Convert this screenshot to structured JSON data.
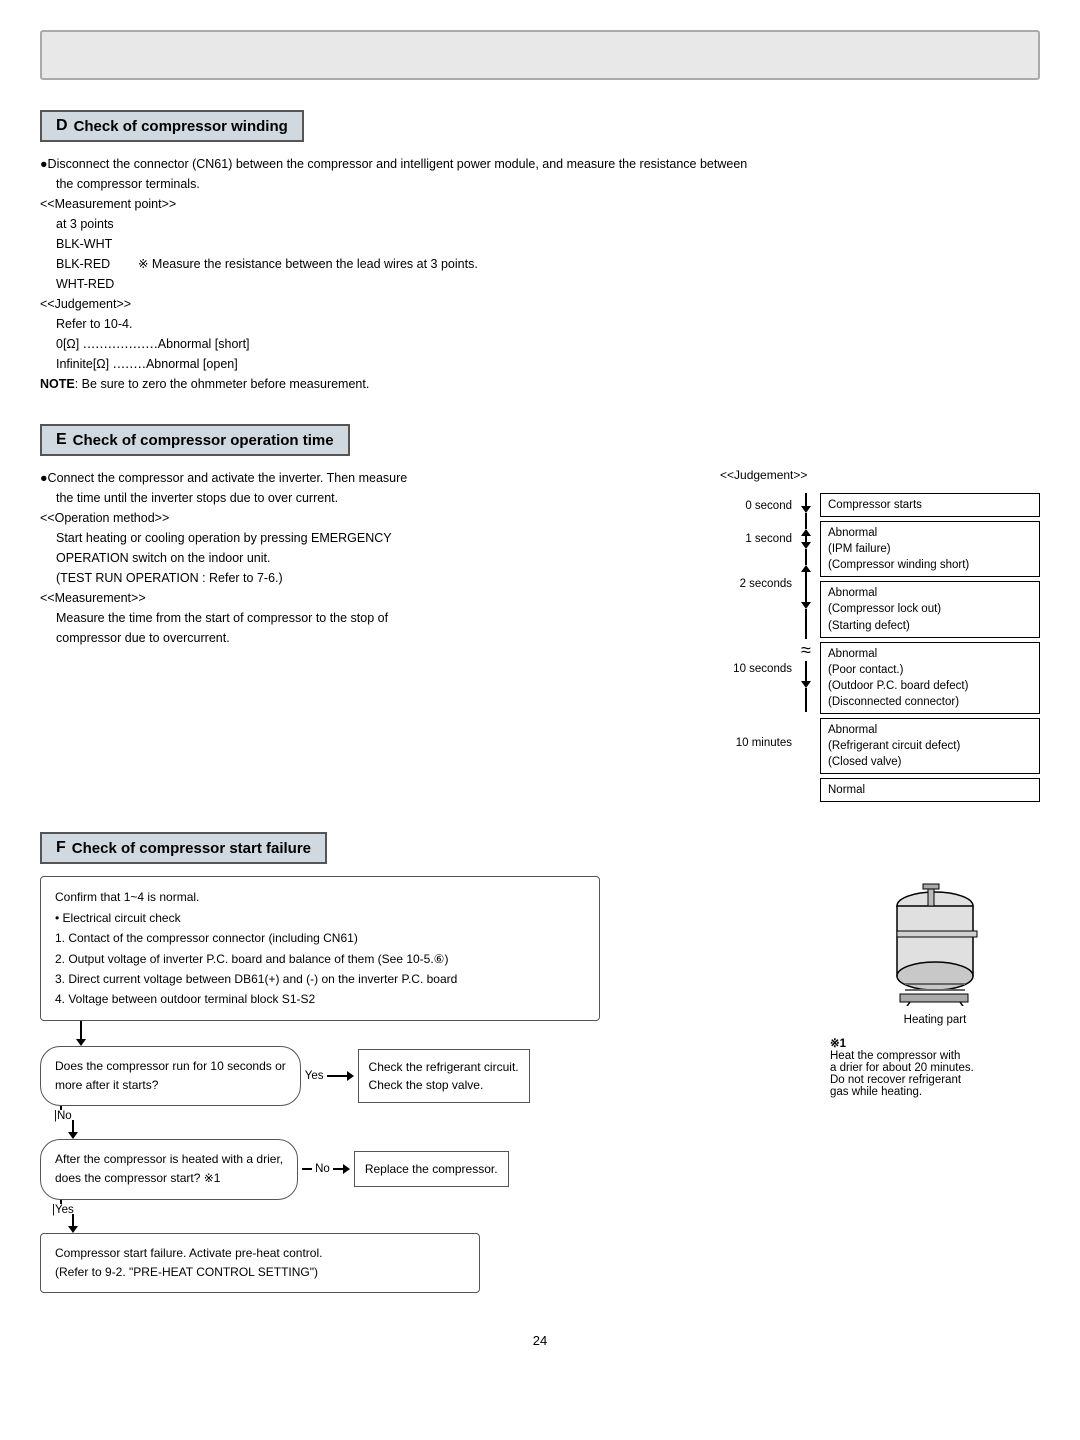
{
  "header": {},
  "sectionD": {
    "letter": "D",
    "title": "Check of compressor winding",
    "para1": "●Disconnect the connector (CN61) between the compressor and intelligent power module, and measure the resistance between",
    "para1b": "the compressor terminals.",
    "measurement_point": "<<Measurement point>>",
    "at3": "at 3 points",
    "blk_wht": "BLK-WHT",
    "blk_red": "BLK-RED",
    "note_measure": "※ Measure the resistance between the lead wires at 3 points.",
    "wht_red": "WHT-RED",
    "judgement": "<<Judgement>>",
    "refer": "Refer to 10-4.",
    "zero": "0[Ω] ‥‥‥‥‥‥‥‥‥Abnormal [short]",
    "infinite": "Infinite[Ω] ‥‥‥‥Abnormal [open]",
    "note": "NOTE",
    "note_text": ": Be sure to zero the ohmmeter before measurement."
  },
  "sectionE": {
    "letter": "E",
    "title": "Check of compressor operation time",
    "para1": "●Connect the compressor and activate the inverter. Then measure",
    "para1b": "the time until the inverter stops due to over current.",
    "op_method": "<<Operation method>>",
    "op1": "Start heating or cooling operation by pressing EMERGENCY",
    "op2": "OPERATION switch on the indoor unit.",
    "op3": "(TEST RUN OPERATION : Refer to 7-6.)",
    "measurement": "<<Measurement>>",
    "meas1": "Measure the time from the start of compressor to the stop of",
    "meas2": "compressor due to overcurrent.",
    "judgement_label": "<<Judgement>>",
    "timeline": [
      {
        "time": "0 second",
        "label": "Compressor starts",
        "type": "start"
      },
      {
        "time": "1 second",
        "label": "Abnormal\n(IPM failure)\n(Compressor winding short)",
        "type": "abnormal"
      },
      {
        "time": "2 seconds",
        "label": "Abnormal\n(Compressor lock out)\n(Starting defect)",
        "type": "abnormal"
      },
      {
        "time": "",
        "label": "Abnormal\n(Poor contact.)\n(Outdoor P.C. board defect)\n(Disconnected connector)",
        "type": "abnormal"
      },
      {
        "time": "10 seconds",
        "label": "",
        "type": "marker"
      },
      {
        "time": "",
        "label": "Abnormal\n(Refrigerant circuit defect)\n(Closed valve)",
        "type": "abnormal"
      },
      {
        "time": "10 minutes",
        "label": "Normal",
        "type": "normal"
      }
    ]
  },
  "sectionF": {
    "letter": "F",
    "title": "Check of compressor start failure",
    "confirm_box": "Confirm that 1~4 is normal.\n• Electrical circuit check\n1. Contact of the compressor connector (including CN61)\n2. Output voltage of inverter P.C. board and balance of them (See 10-5.⑥)\n3. Direct current voltage between DB61(+) and (-) on the inverter P.C. board\n4. Voltage between outdoor terminal block S1-S2",
    "q1": "Does the compressor run for 10 seconds or\nmore after it starts?",
    "q1_yes": "Yes",
    "q1_no": "No",
    "q2": "After the compressor is heated with a drier,\ndoes the compressor start? ※1",
    "q2_yes": "Yes",
    "q2_no": "No",
    "result_yes": "Check the refrigerant circuit.\nCheck the stop valve.",
    "result_no": "Replace the compressor.",
    "result_start_failure": "Compressor start failure. Activate pre-heat control.\n(Refer to 9-2. \"PRE-HEAT CONTROL SETTING\")",
    "note1_label": "※1",
    "note1_text": "Heat the compressor with\na drier for about 20 minutes.\nDo not recover refrigerant\ngas while heating.",
    "heating_part": "Heating part"
  },
  "page_number": "24"
}
